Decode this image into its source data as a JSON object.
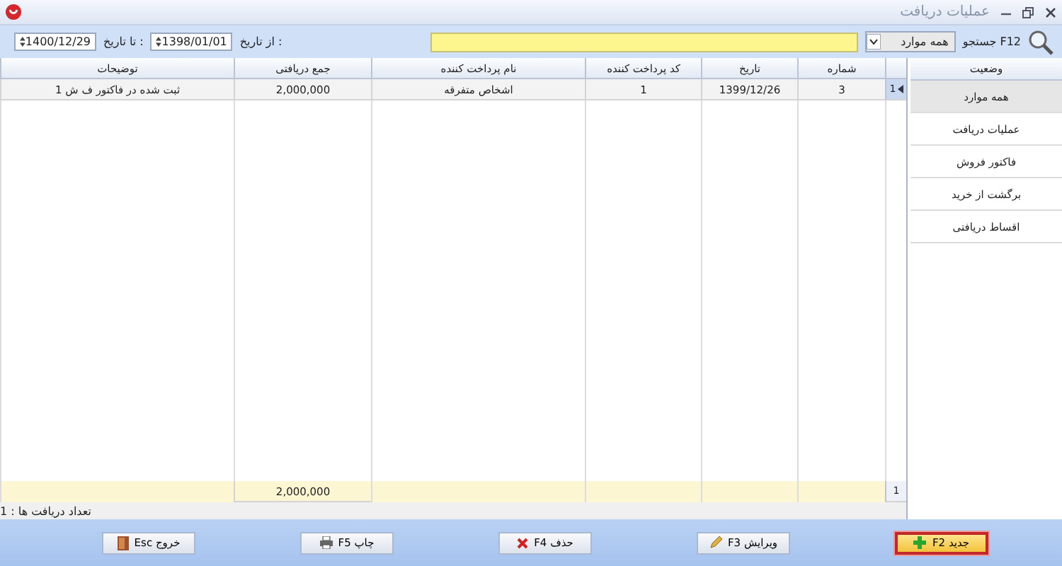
{
  "window": {
    "title": "عملیات دریافت"
  },
  "toolbar": {
    "search_label": "جستجو F12",
    "filter": "همه موارد",
    "from_label": "از تاریخ :",
    "from_date": "1398/01/01",
    "to_label": "تا تاریخ :",
    "to_date": "1400/12/29"
  },
  "table": {
    "columns": [
      "شماره",
      "تاریخ",
      "کد پرداخت کننده",
      "نام پرداخت کننده",
      "جمع دریافتی",
      "توضیحات"
    ],
    "rows": [
      {
        "selected": true,
        "indicator": "1",
        "cells": [
          "3",
          "1399/12/26",
          "1",
          "اشخاص متفرقه",
          "2,000,000",
          "ثبت شده در فاکتور ف ش 1"
        ]
      }
    ],
    "footer": {
      "indicator": "1",
      "total": "2,000,000"
    }
  },
  "sidebar": {
    "heading": "وضعیت",
    "items": [
      {
        "label": "همه موارد",
        "selected": true
      },
      {
        "label": "عملیات دریافت",
        "selected": false
      },
      {
        "label": "فاکتور فروش",
        "selected": false
      },
      {
        "label": "برگشت از خرید",
        "selected": false
      },
      {
        "label": "اقساط دریافتی",
        "selected": false
      }
    ]
  },
  "status_bar": "تعداد دریافت ها : 1",
  "buttons": [
    {
      "label": "جدید F2",
      "kind": "plus",
      "selected": true
    },
    {
      "label": "ویرایش F3",
      "kind": "pencil",
      "selected": false
    },
    {
      "label": "حذف F4",
      "kind": "cross",
      "selected": false
    },
    {
      "label": "چاپ F5",
      "kind": "printer",
      "selected": false
    },
    {
      "label": "خروج Esc",
      "kind": "door",
      "selected": false
    }
  ]
}
